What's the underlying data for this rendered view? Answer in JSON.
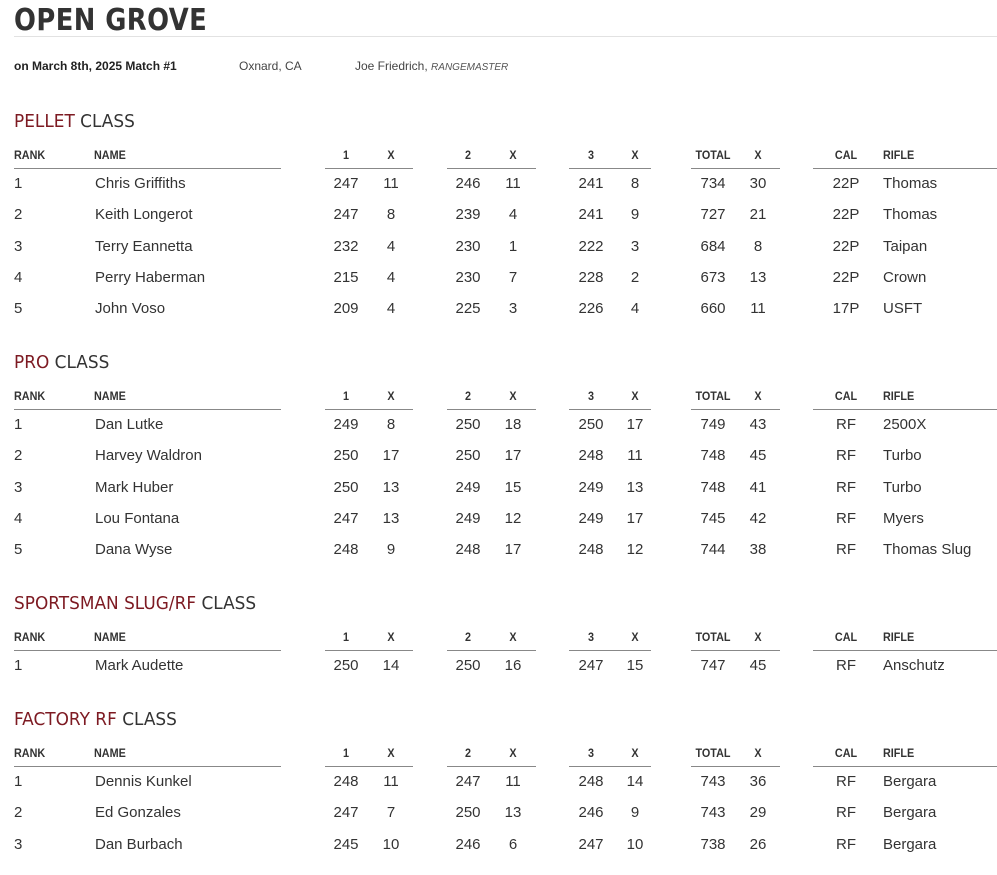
{
  "event": {
    "title": "OPEN GROVE",
    "date_match": "on March 8th, 2025 Match #1",
    "location": "Oxnard, CA",
    "rangemaster_name": "Joe Friedrich,",
    "rangemaster_role": "RANGEMASTER"
  },
  "columns": [
    "RANK",
    "NAME",
    "1",
    "X",
    "2",
    "X",
    "3",
    "X",
    "TOTAL",
    "X",
    "CAL",
    "RIFLE"
  ],
  "classes": [
    {
      "name": "PELLET",
      "suffix": "CLASS",
      "rows": [
        [
          "1",
          "Chris Griffiths",
          "247",
          "11",
          "246",
          "11",
          "241",
          "8",
          "734",
          "30",
          "22P",
          "Thomas"
        ],
        [
          "2",
          "Keith Longerot",
          "247",
          "8",
          "239",
          "4",
          "241",
          "9",
          "727",
          "21",
          "22P",
          "Thomas"
        ],
        [
          "3",
          "Terry Eannetta",
          "232",
          "4",
          "230",
          "1",
          "222",
          "3",
          "684",
          "8",
          "22P",
          "Taipan"
        ],
        [
          "4",
          "Perry Haberman",
          "215",
          "4",
          "230",
          "7",
          "228",
          "2",
          "673",
          "13",
          "22P",
          "Crown"
        ],
        [
          "5",
          "John Voso",
          "209",
          "4",
          "225",
          "3",
          "226",
          "4",
          "660",
          "11",
          "17P",
          "USFT"
        ]
      ]
    },
    {
      "name": "PRO",
      "suffix": "CLASS",
      "rows": [
        [
          "1",
          "Dan Lutke",
          "249",
          "8",
          "250",
          "18",
          "250",
          "17",
          "749",
          "43",
          "RF",
          "2500X"
        ],
        [
          "2",
          "Harvey Waldron",
          "250",
          "17",
          "250",
          "17",
          "248",
          "11",
          "748",
          "45",
          "RF",
          "Turbo"
        ],
        [
          "3",
          "Mark Huber",
          "250",
          "13",
          "249",
          "15",
          "249",
          "13",
          "748",
          "41",
          "RF",
          "Turbo"
        ],
        [
          "4",
          "Lou Fontana",
          "247",
          "13",
          "249",
          "12",
          "249",
          "17",
          "745",
          "42",
          "RF",
          "Myers"
        ],
        [
          "5",
          "Dana Wyse",
          "248",
          "9",
          "248",
          "17",
          "248",
          "12",
          "744",
          "38",
          "RF",
          "Thomas Slug"
        ]
      ]
    },
    {
      "name": "SPORTSMAN SLUG/RF",
      "suffix": "CLASS",
      "rows": [
        [
          "1",
          "Mark Audette",
          "250",
          "14",
          "250",
          "16",
          "247",
          "15",
          "747",
          "45",
          "RF",
          "Anschutz"
        ]
      ]
    },
    {
      "name": "FACTORY RF",
      "suffix": "CLASS",
      "rows": [
        [
          "1",
          "Dennis Kunkel",
          "248",
          "11",
          "247",
          "11",
          "248",
          "14",
          "743",
          "36",
          "RF",
          "Bergara"
        ],
        [
          "2",
          "Ed Gonzales",
          "247",
          "7",
          "250",
          "13",
          "246",
          "9",
          "743",
          "29",
          "RF",
          "Bergara"
        ],
        [
          "3",
          "Dan Burbach",
          "245",
          "10",
          "246",
          "6",
          "247",
          "10",
          "738",
          "26",
          "RF",
          "Bergara"
        ]
      ]
    }
  ]
}
